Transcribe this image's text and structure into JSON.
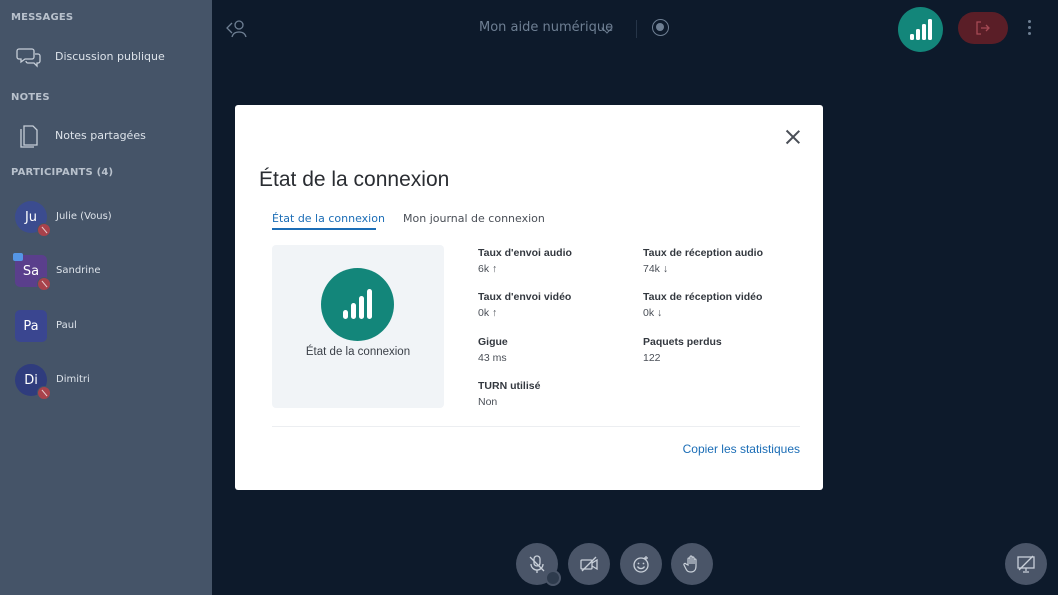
{
  "sidebar": {
    "messages_title": "MESSAGES",
    "public_chat": "Discussion publique",
    "notes_title": "NOTES",
    "shared_notes": "Notes partagées",
    "participants_title": "PARTICIPANTS (4)",
    "participants": [
      {
        "initials": "Ju",
        "name": "Julie (Vous)",
        "color": "#3b4c8f"
      },
      {
        "initials": "Sa",
        "name": "Sandrine",
        "color": "#5a3f8c"
      },
      {
        "initials": "Pa",
        "name": "Paul",
        "color": "#3a4690"
      },
      {
        "initials": "Di",
        "name": "Dimitri",
        "color": "#2f3c7d"
      }
    ]
  },
  "topbar": {
    "meeting_title": "Mon aide numérique"
  },
  "modal": {
    "title": "État de la connexion",
    "tabs": [
      "État de la connexion",
      "Mon journal de connexion"
    ],
    "panel_label": "État de la connexion",
    "stats": {
      "audio_up_label": "Taux d'envoi audio",
      "audio_up_value": "6k ↑",
      "audio_down_label": "Taux de réception audio",
      "audio_down_value": "74k ↓",
      "video_up_label": "Taux d'envoi vidéo",
      "video_up_value": "0k ↑",
      "video_down_label": "Taux de réception vidéo",
      "video_down_value": "0k ↓",
      "jitter_label": "Gigue",
      "jitter_value": "43 ms",
      "lost_label": "Paquets perdus",
      "lost_value": "122",
      "turn_label": "TURN utilisé",
      "turn_value": "Non"
    },
    "copy_label": "Copier les statistiques"
  },
  "colors": {
    "accent": "#13867a",
    "link": "#1b6db6",
    "leave": "#5a1e27"
  }
}
